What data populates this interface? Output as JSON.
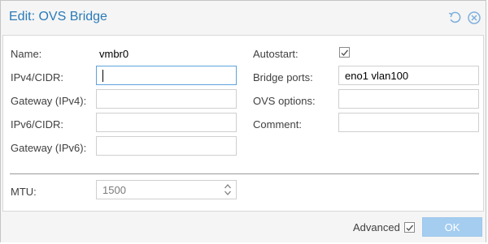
{
  "window": {
    "title": "Edit: OVS Bridge"
  },
  "icons": {
    "reset": "reset-icon",
    "close": "close-icon"
  },
  "form": {
    "name_label": "Name:",
    "name_value": "vmbr0",
    "ipv4_label": "IPv4/CIDR:",
    "ipv4_value": "",
    "gateway4_label": "Gateway (IPv4):",
    "gateway4_value": "",
    "ipv6_label": "IPv6/CIDR:",
    "ipv6_value": "",
    "gateway6_label": "Gateway (IPv6):",
    "gateway6_value": "",
    "autostart_label": "Autostart:",
    "autostart_checked": true,
    "bridge_ports_label": "Bridge ports:",
    "bridge_ports_value": "eno1 vlan100",
    "ovs_options_label": "OVS options:",
    "ovs_options_value": "",
    "comment_label": "Comment:",
    "comment_value": "",
    "mtu_label": "MTU:",
    "mtu_value": "1500"
  },
  "footer": {
    "advanced_label": "Advanced",
    "advanced_checked": true,
    "ok_label": "OK"
  },
  "colors": {
    "title": "#2a7ab8",
    "ok_button": "#a5cdf0",
    "focus_border": "#5fa2dd"
  }
}
